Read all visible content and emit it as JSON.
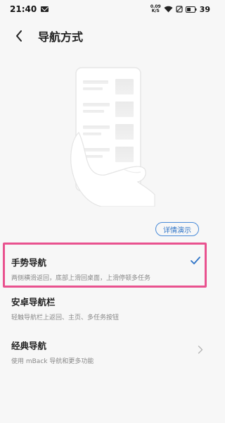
{
  "status_bar": {
    "time": "21:40",
    "net_speed_value": "0.09",
    "net_speed_unit": "K/S",
    "battery": "39"
  },
  "header": {
    "title": "导航方式"
  },
  "detail_button": {
    "label": "详情演示"
  },
  "options": [
    {
      "title": "手势导航",
      "description": "两侧横滑返回，底部上滑回桌面，上滑停顿多任务",
      "selected": true
    },
    {
      "title": "安卓导航栏",
      "description": "轻触导航栏上返回、主页、多任务按钮",
      "selected": false
    },
    {
      "title": "经典导航",
      "description": "使用 mBack 导航和更多功能",
      "selected": false
    }
  ],
  "colors": {
    "accent": "#2f74c7",
    "highlight": "#e9528f",
    "background": "#f7f7f7"
  }
}
